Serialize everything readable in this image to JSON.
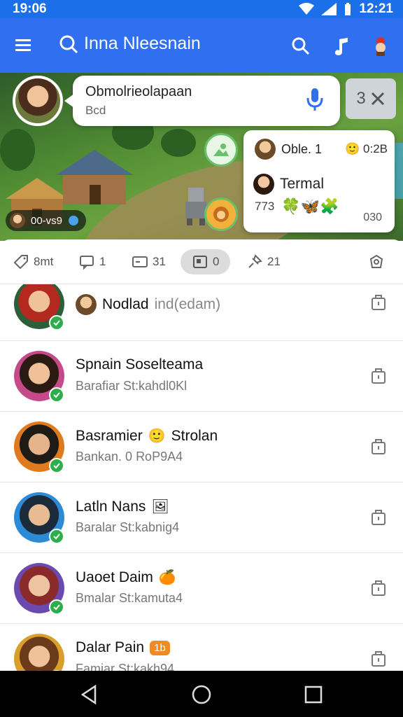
{
  "status_bar": {
    "time": "19:06",
    "battery_time": "12:21"
  },
  "app_bar": {
    "title": "Inna Nleesnain"
  },
  "scene": {
    "chat_bubble": {
      "line1": "Obmolrieolapaan",
      "line2": "Bcd"
    },
    "close_chip_label": "3",
    "popup": {
      "row1_name": "Oble. 1",
      "row1_value": "0:2B",
      "row2_name": "Termal",
      "row3_value": "773",
      "row3_num": "030"
    },
    "game_chip": {
      "label": "00-vs9"
    }
  },
  "tabs": [
    {
      "label": "8mt",
      "icon": "tag-icon"
    },
    {
      "label": "1",
      "icon": "chat-icon"
    },
    {
      "label": "31",
      "icon": "card-icon"
    },
    {
      "label": "0",
      "icon": "photo-icon"
    },
    {
      "label": "21",
      "icon": "pin-icon"
    },
    {
      "label": "",
      "icon": "badge-icon"
    }
  ],
  "contacts": [
    {
      "name": "Nodlad",
      "name_extra": "ind(edam)",
      "subtitle": "",
      "emoji": "",
      "tag": ""
    },
    {
      "name": "Spnain Soselteama",
      "name_extra": "",
      "subtitle": "Barafiar St:kahdl0Kl",
      "emoji": "",
      "tag": ""
    },
    {
      "name": "Basramier",
      "name_extra": "Strolan",
      "subtitle": "Bankan. 0 RoP9A4",
      "emoji": "🙂",
      "tag": ""
    },
    {
      "name": "Latln Nans",
      "name_extra": "",
      "subtitle": "Baralar St:kabnig4",
      "emoji": "🖼",
      "tag": ""
    },
    {
      "name": "Uaoet Daim",
      "name_extra": "",
      "subtitle": "Bmalar St:kamuta4",
      "emoji": "🍊",
      "tag": ""
    },
    {
      "name": "Dalar Pain",
      "name_extra": "",
      "subtitle": "Famiar St:kakh94",
      "emoji": "",
      "tag": "1b"
    }
  ],
  "colors": {
    "app_bar": "#2f6ff0",
    "status_bar": "#1b6fe8",
    "online_badge": "#2eae4a"
  }
}
